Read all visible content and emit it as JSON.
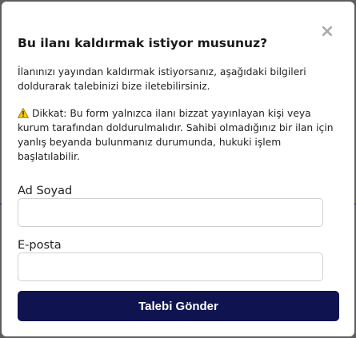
{
  "dialog": {
    "title": "Bu ilanı kaldırmak istiyor musunuz?",
    "close_symbol": "×",
    "description": "İlanınızı yayından kaldırmak istiyorsanız, aşağıdaki bilgileri doldurarak talebinizi bize iletebilirsiniz.",
    "warning": {
      "icon": "warning-icon",
      "text": "Dikkat: Bu form yalnızca ilanı bizzat yayınlayan kişi veya kurum tarafından doldurulmalıdır. Sahibi olmadığınız bir ilan için yanlış beyanda bulunmanız durumunda, hukuki işlem başlatılabilir."
    },
    "fields": {
      "name": {
        "label": "Ad Soyad",
        "value": "",
        "placeholder": ""
      },
      "email": {
        "label": "E-posta",
        "value": "",
        "placeholder": ""
      }
    },
    "submit_label": "Talebi Gönder"
  },
  "colors": {
    "overlay": "#5e5e5e",
    "modal_bg": "#ffffff",
    "button_bg": "#0f1451",
    "button_text": "#ffffff",
    "close_icon": "#a9a9a9",
    "warning_fill": "#f7c600"
  }
}
